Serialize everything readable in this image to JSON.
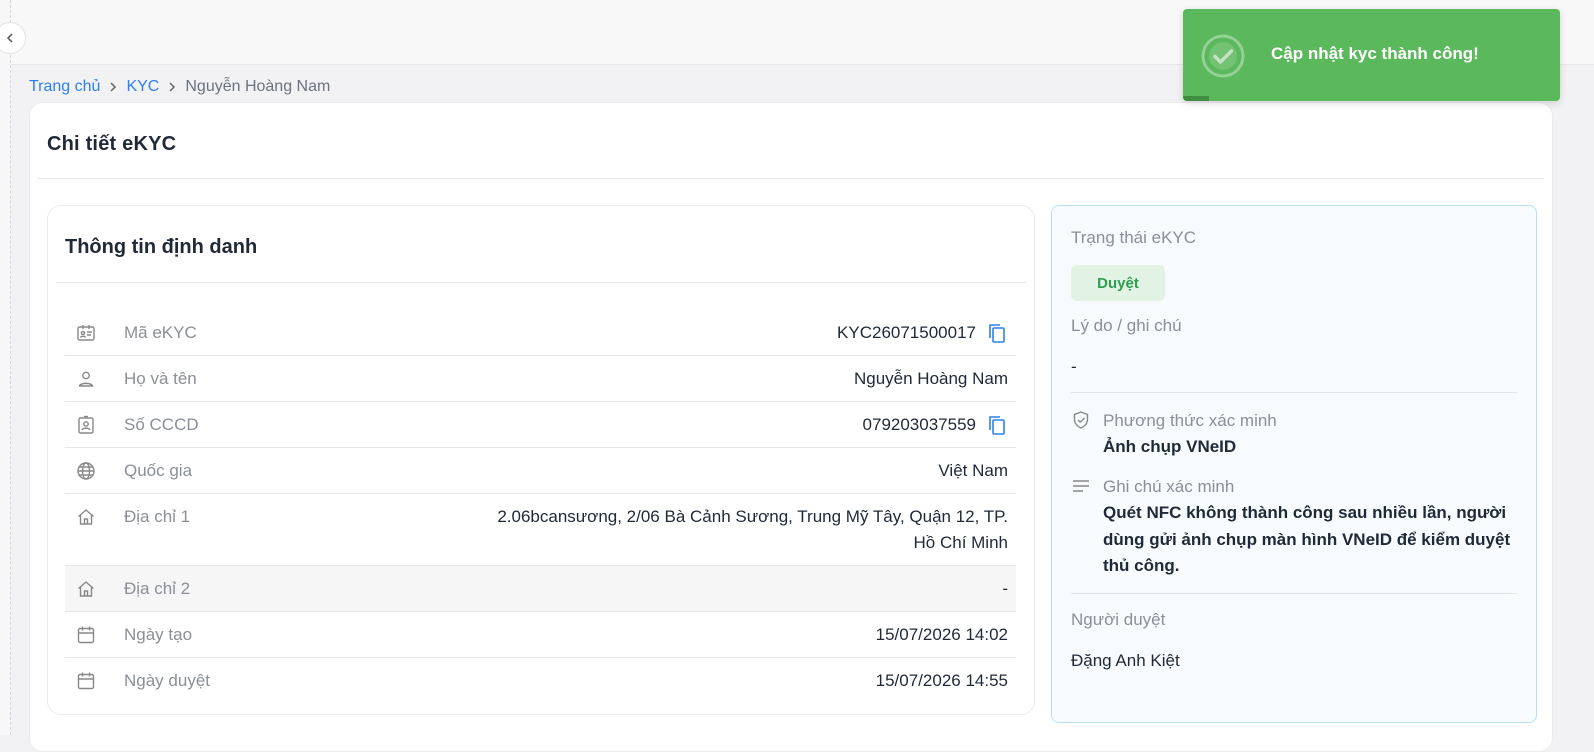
{
  "breadcrumb": {
    "home": "Trang chủ",
    "kyc": "KYC",
    "current": "Nguyễn Hoàng Nam"
  },
  "page": {
    "title": "Chi tiết eKYC"
  },
  "identity": {
    "title": "Thông tin định danh",
    "rows": [
      {
        "icon": "id-card-icon",
        "label": "Mã eKYC",
        "value": "KYC26071500017",
        "copy": true
      },
      {
        "icon": "user-icon",
        "label": "Họ và tên",
        "value": "Nguyễn Hoàng Nam",
        "copy": false
      },
      {
        "icon": "id-badge-icon",
        "label": "Số CCCD",
        "value": "079203037559",
        "copy": true
      },
      {
        "icon": "globe-icon",
        "label": "Quốc gia",
        "value": "Việt Nam",
        "copy": false
      },
      {
        "icon": "home-icon",
        "label": "Địa chỉ 1",
        "value": "2.06bcansương, 2/06 Bà Cảnh Sương, Trung Mỹ Tây, Quận 12, TP. Hồ Chí Minh",
        "copy": false
      },
      {
        "icon": "home-icon",
        "label": "Địa chỉ 2",
        "value": "-",
        "copy": false
      },
      {
        "icon": "calendar-icon",
        "label": "Ngày tạo",
        "value": "15/07/2026 14:02",
        "copy": false
      },
      {
        "icon": "calendar-icon",
        "label": "Ngày duyệt",
        "value": "15/07/2026 14:55",
        "copy": false
      }
    ]
  },
  "status": {
    "status_label": "Trạng thái eKYC",
    "status_badge": "Duyệt",
    "reason_label": "Lý do / ghi chú",
    "reason_value": "-",
    "method_label": "Phương thức xác minh",
    "method_value": "Ảnh chụp VNeID",
    "note_label": "Ghi chú xác minh",
    "note_value": "Quét NFC không thành công sau nhiều lần, người dùng gửi ảnh chụp màn hình VNeID để kiểm duyệt thủ công.",
    "approver_label": "Người duyệt",
    "approver_value": "Đặng Anh Kiệt"
  },
  "toast": {
    "message": "Cập nhật kyc thành công!",
    "progress": 0.07
  },
  "colors": {
    "link": "#2f80ed",
    "success": "#5cb85c",
    "badge_bg": "#e2f3e6",
    "badge_text": "#2e9e4f"
  }
}
